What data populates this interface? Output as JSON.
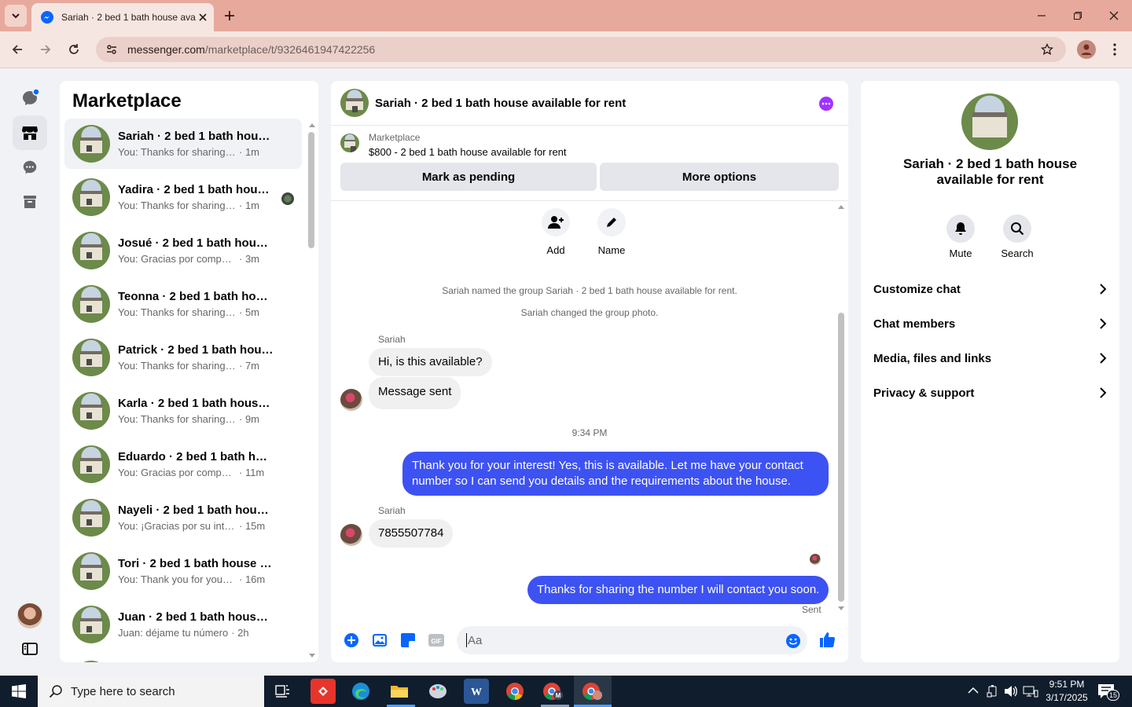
{
  "browser": {
    "tab_title": "Sariah · 2 bed 1 bath house ava",
    "url_domain": "messenger.com",
    "url_path": "/marketplace/t/9326461947422256"
  },
  "rail": {
    "items": [
      "chats-icon",
      "marketplace-icon",
      "requests-icon",
      "archive-icon"
    ]
  },
  "sidebar": {
    "title": "Marketplace",
    "conversations": [
      {
        "name": "Sariah · 2 bed 1 bath house...",
        "preview": "You: Thanks for sharing the ...",
        "time": "· 1m"
      },
      {
        "name": "Yadira · 2 bed 1 bath house...",
        "preview": "You: Thanks for sharing the ...",
        "time": "· 1m"
      },
      {
        "name": "Josué · 2 bed 1 bath house ...",
        "preview": "You: Gracias por compartir el...",
        "time": "· 3m"
      },
      {
        "name": "Teonna · 2 bed 1 bath hous...",
        "preview": "You: Thanks for sharing the ...",
        "time": "· 5m"
      },
      {
        "name": "Patrick · 2 bed 1 bath hous...",
        "preview": "You: Thanks for sharing the ...",
        "time": "· 7m"
      },
      {
        "name": "Karla · 2 bed 1 bath house ...",
        "preview": "You: Thanks for sharing the ...",
        "time": "· 9m"
      },
      {
        "name": "Eduardo · 2 bed 1 bath hou...",
        "preview": "You: Gracias por compartir ...",
        "time": "· 11m"
      },
      {
        "name": "Nayeli · 2 bed 1 bath house...",
        "preview": "You: ¡Gracias por su interés!...",
        "time": "· 15m"
      },
      {
        "name": "Tori · 2 bed 1 bath house av...",
        "preview": "You: Thank you for your int...",
        "time": "· 16m"
      },
      {
        "name": "Juan · 2 bed 1 bath house a...",
        "preview": "Juan: déjame tu número",
        "time": "· 2h"
      }
    ]
  },
  "chat": {
    "title": "Sariah · 2 bed 1 bath house available for rent",
    "listing": {
      "source": "Marketplace",
      "detail": "$800 - 2 bed 1 bath house available for rent",
      "mark_pending": "Mark as pending",
      "more_options": "More options"
    },
    "group_actions": {
      "add": "Add",
      "name": "Name"
    },
    "system_1": "Sariah named the group Sariah · 2 bed 1 bath house available for rent.",
    "system_2": "Sariah changed the group photo.",
    "sender_1": "Sariah",
    "msg_1": "Hi, is this available?",
    "msg_2": "Message sent",
    "timestamp": "9:34 PM",
    "msg_3": "Thank you for your interest! Yes, this is available. Let me have your contact number so I can send you details and the requirements about the house.",
    "sender_2": "Sariah",
    "msg_4": "7855507784",
    "msg_5": "Thanks for sharing the number I will contact you soon.",
    "status": "Sent",
    "input_placeholder": "Aa"
  },
  "info": {
    "title": "Sariah · 2 bed 1 bath house available for rent",
    "mute": "Mute",
    "search": "Search",
    "items": [
      "Customize chat",
      "Chat members",
      "Media, files and links",
      "Privacy & support"
    ]
  },
  "taskbar": {
    "search_placeholder": "Type here to search",
    "time": "9:51 PM",
    "date": "3/17/2025",
    "notifications": "15"
  },
  "colors": {
    "accent": "#0866ff",
    "outgoing_bubble": "#3d52f2",
    "tabbar": "#e8a99d"
  }
}
